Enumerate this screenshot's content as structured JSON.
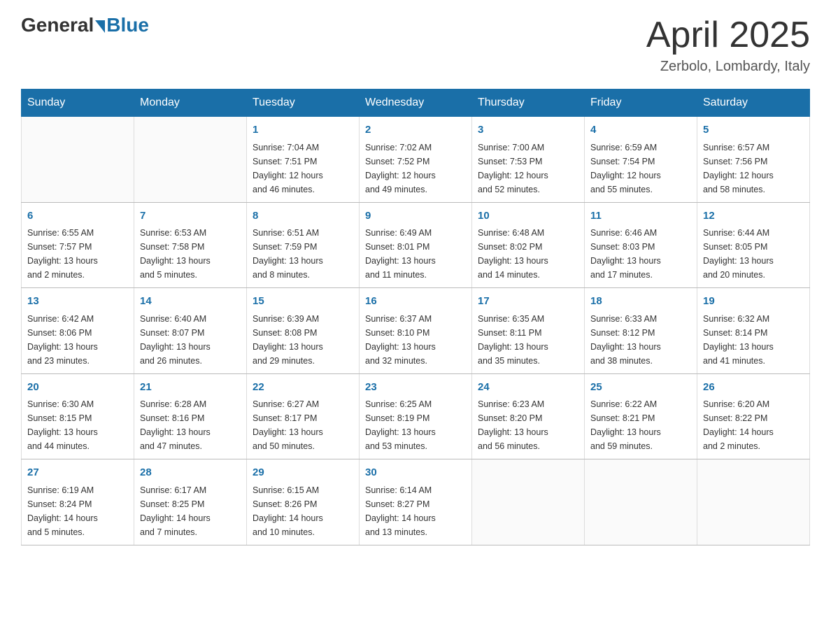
{
  "header": {
    "logo_general": "General",
    "logo_blue": "Blue",
    "month_year": "April 2025",
    "location": "Zerbolo, Lombardy, Italy"
  },
  "days_of_week": [
    "Sunday",
    "Monday",
    "Tuesday",
    "Wednesday",
    "Thursday",
    "Friday",
    "Saturday"
  ],
  "weeks": [
    [
      {
        "day": "",
        "info": ""
      },
      {
        "day": "",
        "info": ""
      },
      {
        "day": "1",
        "info": "Sunrise: 7:04 AM\nSunset: 7:51 PM\nDaylight: 12 hours\nand 46 minutes."
      },
      {
        "day": "2",
        "info": "Sunrise: 7:02 AM\nSunset: 7:52 PM\nDaylight: 12 hours\nand 49 minutes."
      },
      {
        "day": "3",
        "info": "Sunrise: 7:00 AM\nSunset: 7:53 PM\nDaylight: 12 hours\nand 52 minutes."
      },
      {
        "day": "4",
        "info": "Sunrise: 6:59 AM\nSunset: 7:54 PM\nDaylight: 12 hours\nand 55 minutes."
      },
      {
        "day": "5",
        "info": "Sunrise: 6:57 AM\nSunset: 7:56 PM\nDaylight: 12 hours\nand 58 minutes."
      }
    ],
    [
      {
        "day": "6",
        "info": "Sunrise: 6:55 AM\nSunset: 7:57 PM\nDaylight: 13 hours\nand 2 minutes."
      },
      {
        "day": "7",
        "info": "Sunrise: 6:53 AM\nSunset: 7:58 PM\nDaylight: 13 hours\nand 5 minutes."
      },
      {
        "day": "8",
        "info": "Sunrise: 6:51 AM\nSunset: 7:59 PM\nDaylight: 13 hours\nand 8 minutes."
      },
      {
        "day": "9",
        "info": "Sunrise: 6:49 AM\nSunset: 8:01 PM\nDaylight: 13 hours\nand 11 minutes."
      },
      {
        "day": "10",
        "info": "Sunrise: 6:48 AM\nSunset: 8:02 PM\nDaylight: 13 hours\nand 14 minutes."
      },
      {
        "day": "11",
        "info": "Sunrise: 6:46 AM\nSunset: 8:03 PM\nDaylight: 13 hours\nand 17 minutes."
      },
      {
        "day": "12",
        "info": "Sunrise: 6:44 AM\nSunset: 8:05 PM\nDaylight: 13 hours\nand 20 minutes."
      }
    ],
    [
      {
        "day": "13",
        "info": "Sunrise: 6:42 AM\nSunset: 8:06 PM\nDaylight: 13 hours\nand 23 minutes."
      },
      {
        "day": "14",
        "info": "Sunrise: 6:40 AM\nSunset: 8:07 PM\nDaylight: 13 hours\nand 26 minutes."
      },
      {
        "day": "15",
        "info": "Sunrise: 6:39 AM\nSunset: 8:08 PM\nDaylight: 13 hours\nand 29 minutes."
      },
      {
        "day": "16",
        "info": "Sunrise: 6:37 AM\nSunset: 8:10 PM\nDaylight: 13 hours\nand 32 minutes."
      },
      {
        "day": "17",
        "info": "Sunrise: 6:35 AM\nSunset: 8:11 PM\nDaylight: 13 hours\nand 35 minutes."
      },
      {
        "day": "18",
        "info": "Sunrise: 6:33 AM\nSunset: 8:12 PM\nDaylight: 13 hours\nand 38 minutes."
      },
      {
        "day": "19",
        "info": "Sunrise: 6:32 AM\nSunset: 8:14 PM\nDaylight: 13 hours\nand 41 minutes."
      }
    ],
    [
      {
        "day": "20",
        "info": "Sunrise: 6:30 AM\nSunset: 8:15 PM\nDaylight: 13 hours\nand 44 minutes."
      },
      {
        "day": "21",
        "info": "Sunrise: 6:28 AM\nSunset: 8:16 PM\nDaylight: 13 hours\nand 47 minutes."
      },
      {
        "day": "22",
        "info": "Sunrise: 6:27 AM\nSunset: 8:17 PM\nDaylight: 13 hours\nand 50 minutes."
      },
      {
        "day": "23",
        "info": "Sunrise: 6:25 AM\nSunset: 8:19 PM\nDaylight: 13 hours\nand 53 minutes."
      },
      {
        "day": "24",
        "info": "Sunrise: 6:23 AM\nSunset: 8:20 PM\nDaylight: 13 hours\nand 56 minutes."
      },
      {
        "day": "25",
        "info": "Sunrise: 6:22 AM\nSunset: 8:21 PM\nDaylight: 13 hours\nand 59 minutes."
      },
      {
        "day": "26",
        "info": "Sunrise: 6:20 AM\nSunset: 8:22 PM\nDaylight: 14 hours\nand 2 minutes."
      }
    ],
    [
      {
        "day": "27",
        "info": "Sunrise: 6:19 AM\nSunset: 8:24 PM\nDaylight: 14 hours\nand 5 minutes."
      },
      {
        "day": "28",
        "info": "Sunrise: 6:17 AM\nSunset: 8:25 PM\nDaylight: 14 hours\nand 7 minutes."
      },
      {
        "day": "29",
        "info": "Sunrise: 6:15 AM\nSunset: 8:26 PM\nDaylight: 14 hours\nand 10 minutes."
      },
      {
        "day": "30",
        "info": "Sunrise: 6:14 AM\nSunset: 8:27 PM\nDaylight: 14 hours\nand 13 minutes."
      },
      {
        "day": "",
        "info": ""
      },
      {
        "day": "",
        "info": ""
      },
      {
        "day": "",
        "info": ""
      }
    ]
  ]
}
